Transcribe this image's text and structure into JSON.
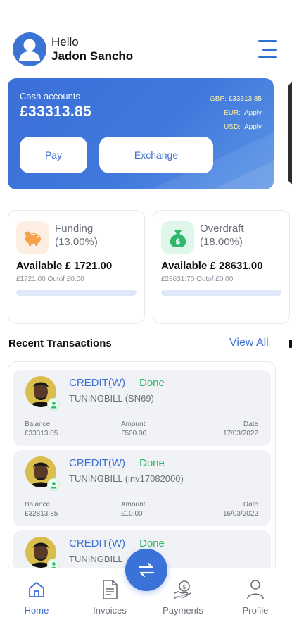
{
  "header": {
    "hello": "Hello",
    "name": "Jadon Sancho"
  },
  "cash_card": {
    "title": "Cash accounts",
    "amount": "£33313.85",
    "currencies": [
      {
        "label": "GBP:",
        "value": "£33313.85"
      },
      {
        "label": "EUR:",
        "value": "Apply"
      },
      {
        "label": "USD:",
        "value": "Apply"
      }
    ],
    "pay_label": "Pay",
    "exchange_label": "Exchange"
  },
  "funding": {
    "title": "Funding",
    "percent": "(13.00%)",
    "available": "Available £  1721.00",
    "sub": "£1721.00 Outof £0.00",
    "progress": 0
  },
  "overdraft": {
    "title": "Overdraft",
    "percent": "(18.00%)",
    "available": "Available £  28631.00",
    "sub": "£28631.70 Outof £0.00",
    "progress": 0
  },
  "transactions": {
    "title": "Recent Transactions",
    "view_all": "View All",
    "labels": {
      "balance": "Balance",
      "amount": "Amount",
      "date": "Date"
    },
    "items": [
      {
        "type": "CREDIT(W)",
        "status": "Done",
        "ref": "TUNINGBILL (SN69)",
        "balance": "£33313.85",
        "amount": "£500.00",
        "date": "17/03/2022"
      },
      {
        "type": "CREDIT(W)",
        "status": "Done",
        "ref": "TUNINGBILL (inv17082000)",
        "balance": "£32813.85",
        "amount": "£10.00",
        "date": "16/03/2022"
      },
      {
        "type": "CREDIT(W)",
        "status": "Done",
        "ref": "TUNINGBILL",
        "balance": "",
        "amount": "",
        "date": ""
      }
    ]
  },
  "nav": {
    "home": "Home",
    "invoices": "Invoices",
    "payments": "Payments",
    "profile": "Profile"
  },
  "colors": {
    "primary": "#3b6fd3",
    "success": "#2fb86b",
    "card_gradient_start": "#3a6fd8",
    "funding_icon_bg": "#fdeee2",
    "overdraft_icon_bg": "#dff7ea"
  },
  "icons": {
    "avatar": "user-avatar-icon",
    "menu": "menu-icon",
    "funding": "piggy-bank-icon",
    "overdraft": "money-bag-icon",
    "fab": "exchange-arrows-icon",
    "home": "home-icon",
    "invoices": "document-icon",
    "payments": "hand-coin-icon",
    "profile": "person-icon"
  }
}
